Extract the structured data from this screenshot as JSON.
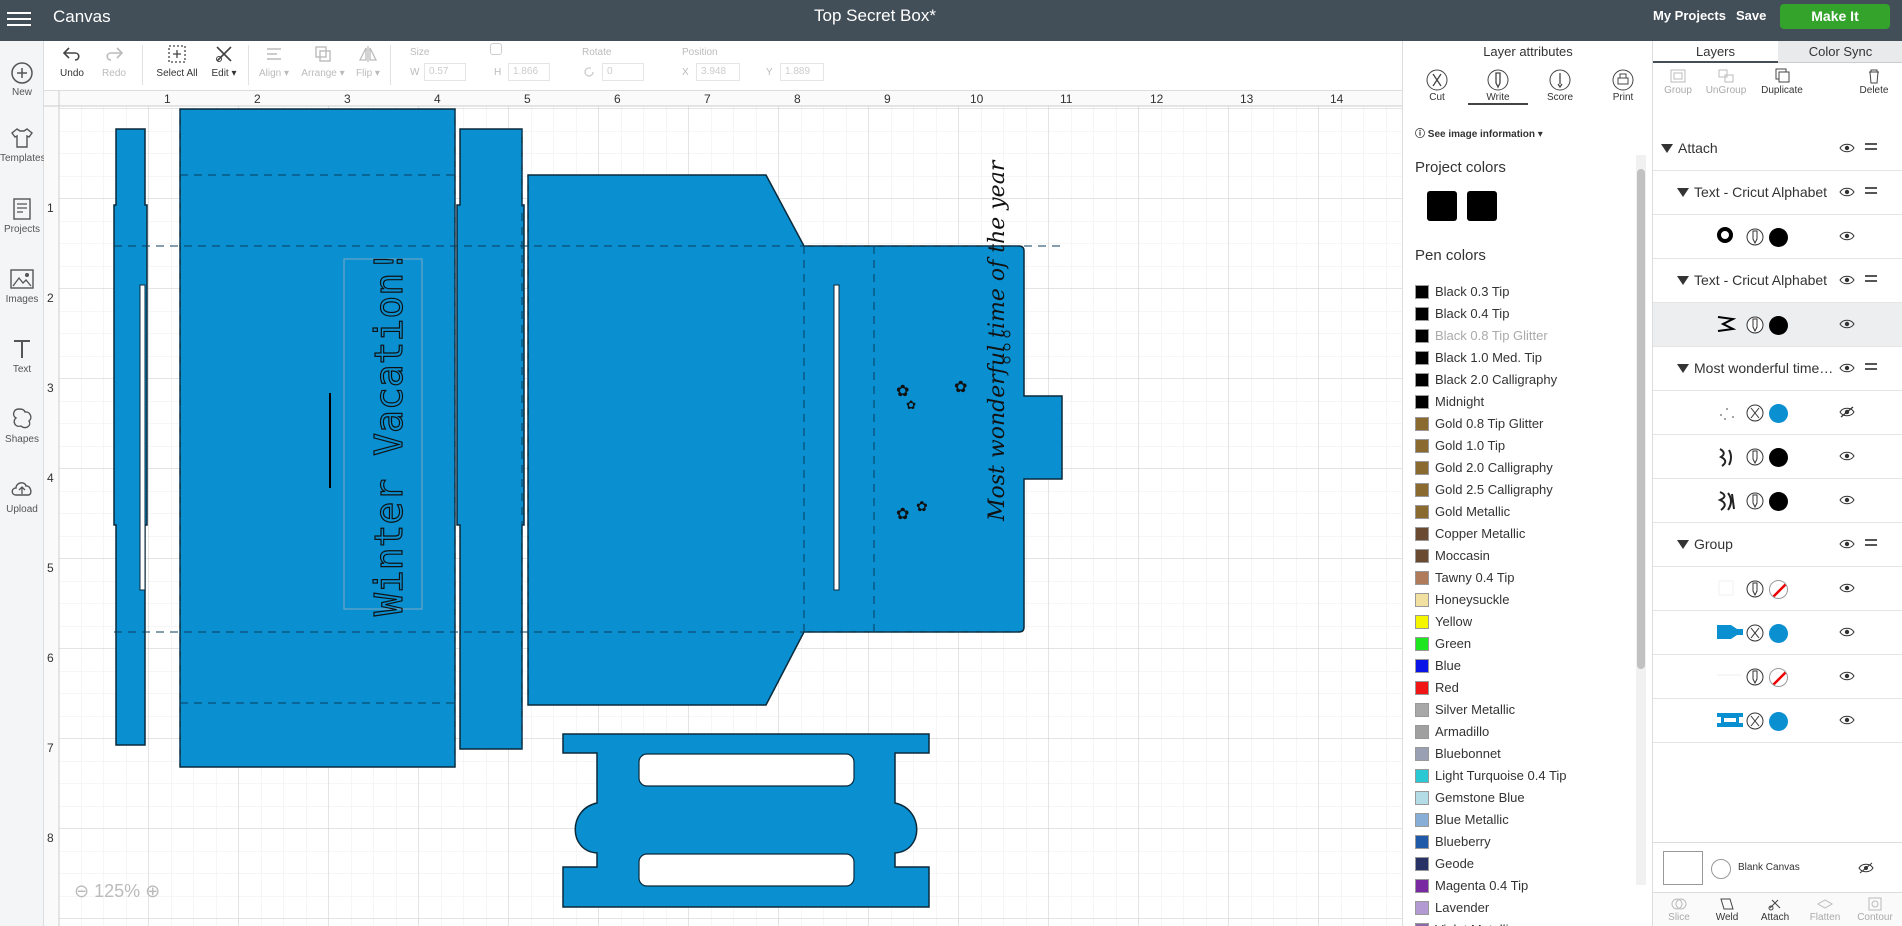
{
  "topbar": {
    "app_title": "Canvas",
    "doc_title": "Top Secret Box*",
    "my_projects": "My Projects",
    "save": "Save",
    "make_it": "Make It"
  },
  "leftnav": {
    "items": [
      {
        "label": "New",
        "icon": "plus-circle-icon"
      },
      {
        "label": "Templates",
        "icon": "shirt-icon"
      },
      {
        "label": "Projects",
        "icon": "projects-icon"
      },
      {
        "label": "Images",
        "icon": "image-icon"
      },
      {
        "label": "Text",
        "icon": "text-icon"
      },
      {
        "label": "Shapes",
        "icon": "shapes-icon"
      },
      {
        "label": "Upload",
        "icon": "cloud-upload-icon"
      }
    ]
  },
  "toolbar": {
    "undo": "Undo",
    "redo": "Redo",
    "select_all": "Select All",
    "edit": "Edit",
    "align": "Align",
    "arrange": "Arrange",
    "flip": "Flip",
    "size_label": "Size",
    "w_label": "W",
    "w_value": "0.57",
    "h_label": "H",
    "h_value": "1.866",
    "rotate_label": "Rotate",
    "rotate_value": "0",
    "position_label": "Position",
    "x_label": "X",
    "x_value": "3.948",
    "y_label": "Y",
    "y_value": "1.889"
  },
  "canvas": {
    "ruler_top": [
      "1",
      "2",
      "3",
      "4",
      "5",
      "6",
      "7",
      "8",
      "9",
      "10",
      "11",
      "12",
      "13",
      "14"
    ],
    "ruler_left": [
      "1",
      "2",
      "3",
      "4",
      "5",
      "6",
      "7",
      "8"
    ],
    "text_object": "Winter Vacation!",
    "image_text": "Most wonderful time of the year",
    "zoom": "125%",
    "design_color": "#0a8fd1"
  },
  "attributes": {
    "title": "Layer attributes",
    "tools": [
      "Cut",
      "Write",
      "Score",
      "Print"
    ],
    "see_info": "See image information",
    "project_colors_title": "Project colors",
    "pen_colors_title": "Pen colors",
    "pen_colors": [
      {
        "name": "Black 0.3 Tip",
        "color": "#000000",
        "muted": false
      },
      {
        "name": "Black 0.4 Tip",
        "color": "#000000",
        "muted": false
      },
      {
        "name": "Black 0.8 Tip Glitter",
        "color": "#000000",
        "muted": true
      },
      {
        "name": "Black 1.0 Med. Tip",
        "color": "#000000",
        "muted": false
      },
      {
        "name": "Black 2.0 Calligraphy",
        "color": "#000000",
        "muted": false
      },
      {
        "name": "Midnight",
        "color": "#000000",
        "muted": false
      },
      {
        "name": "Gold 0.8 Tip Glitter",
        "color": "#8a6a2e",
        "muted": false
      },
      {
        "name": "Gold 1.0 Tip",
        "color": "#8a6a2e",
        "muted": false
      },
      {
        "name": "Gold 2.0 Calligraphy",
        "color": "#8a6a2e",
        "muted": false
      },
      {
        "name": "Gold 2.5 Calligraphy",
        "color": "#8a6a2e",
        "muted": false
      },
      {
        "name": "Gold Metallic",
        "color": "#8a6a2e",
        "muted": false
      },
      {
        "name": "Copper Metallic",
        "color": "#6b4a32",
        "muted": false
      },
      {
        "name": "Moccasin",
        "color": "#6b4a32",
        "muted": false
      },
      {
        "name": "Tawny 0.4 Tip",
        "color": "#b07b5a",
        "muted": false
      },
      {
        "name": "Honeysuckle",
        "color": "#f2e0a0",
        "muted": false
      },
      {
        "name": "Yellow",
        "color": "#f5f500",
        "muted": false
      },
      {
        "name": "Green",
        "color": "#1ee61e",
        "muted": false
      },
      {
        "name": "Blue",
        "color": "#0a14e6",
        "muted": false
      },
      {
        "name": "Red",
        "color": "#f01414",
        "muted": false
      },
      {
        "name": "Silver Metallic",
        "color": "#a8a8a8",
        "muted": false
      },
      {
        "name": "Armadillo",
        "color": "#a0a0a0",
        "muted": false
      },
      {
        "name": "Bluebonnet",
        "color": "#9aa0b4",
        "muted": false
      },
      {
        "name": "Light Turquoise 0.4 Tip",
        "color": "#2ac8d2",
        "muted": false
      },
      {
        "name": "Gemstone Blue",
        "color": "#b4dce6",
        "muted": false
      },
      {
        "name": "Blue Metallic",
        "color": "#86aed6",
        "muted": false
      },
      {
        "name": "Blueberry",
        "color": "#1e5aa8",
        "muted": false
      },
      {
        "name": "Geode",
        "color": "#283264",
        "muted": false
      },
      {
        "name": "Magenta 0.4 Tip",
        "color": "#7a2aa0",
        "muted": false
      },
      {
        "name": "Lavender",
        "color": "#b49ad2",
        "muted": false
      },
      {
        "name": "Violet Metallic",
        "color": "#8a6aa8",
        "muted": false
      }
    ]
  },
  "layers": {
    "tabs": [
      "Layers",
      "Color Sync"
    ],
    "tools": [
      "Group",
      "UnGroup",
      "Duplicate",
      "Delete"
    ],
    "rows": [
      {
        "type": "group",
        "label": "Attach",
        "indent": 0
      },
      {
        "type": "group",
        "label": "Text - Cricut Alphabet",
        "indent": 1
      },
      {
        "type": "item",
        "thumb": "ring",
        "op": "write",
        "color": "#000000",
        "hidden": false,
        "selected": false
      },
      {
        "type": "group",
        "label": "Text - Cricut Alphabet",
        "indent": 1
      },
      {
        "type": "item",
        "thumb": "glyph",
        "op": "write",
        "color": "#000000",
        "hidden": false,
        "selected": true
      },
      {
        "type": "group",
        "label": "Most wonderful time…",
        "indent": 1
      },
      {
        "type": "item",
        "thumb": "dots",
        "op": "cut",
        "color": "#0a8fd1",
        "hidden": true,
        "selected": false
      },
      {
        "type": "item",
        "thumb": "script",
        "op": "write",
        "color": "#000000",
        "hidden": false,
        "selected": false
      },
      {
        "type": "item",
        "thumb": "script2",
        "op": "write",
        "color": "#000000",
        "hidden": false,
        "selected": false
      },
      {
        "type": "group",
        "label": "Group",
        "indent": 1
      },
      {
        "type": "item",
        "thumb": "blank",
        "op": "write",
        "color": "none",
        "hidden": false,
        "selected": false
      },
      {
        "type": "item",
        "thumb": "boxpiece",
        "op": "cut",
        "color": "#0a8fd1",
        "hidden": false,
        "selected": false
      },
      {
        "type": "item",
        "thumb": "blank2",
        "op": "write",
        "color": "none",
        "hidden": false,
        "selected": false
      },
      {
        "type": "item",
        "thumb": "strap",
        "op": "cut",
        "color": "#0a8fd1",
        "hidden": false,
        "selected": false
      }
    ],
    "blank_canvas": "Blank Canvas",
    "bottom_tools": [
      "Slice",
      "Weld",
      "Attach",
      "Flatten",
      "Contour"
    ]
  }
}
